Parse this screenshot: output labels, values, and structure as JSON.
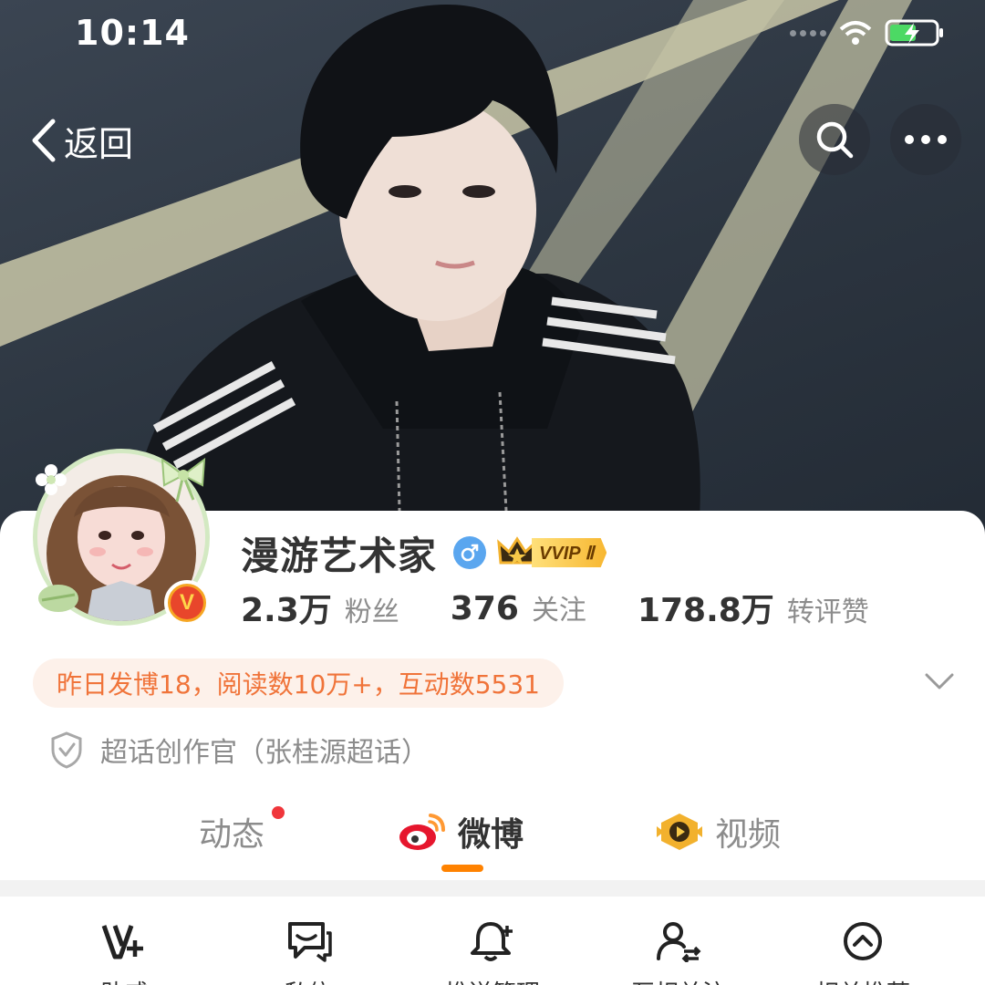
{
  "status_bar": {
    "time": "10:14"
  },
  "nav": {
    "back_label": "返回"
  },
  "profile": {
    "username": "漫游艺术家",
    "vip_level": "VVIP Ⅱ",
    "stats": [
      {
        "value": "2.3万",
        "label": "粉丝"
      },
      {
        "value": "376",
        "label": "关注"
      },
      {
        "value": "178.8万",
        "label": "转评赞"
      }
    ],
    "activity_summary": "昨日发博18，阅读数10万+，互动数5531",
    "super_topic_title": "超话创作官（张桂源超话）"
  },
  "tabs": [
    {
      "label": "动态",
      "has_dot": true
    },
    {
      "label": "微博",
      "active": true
    },
    {
      "label": "视频"
    }
  ],
  "bottom_bar": [
    {
      "label": "助威",
      "icon": "v-plus-icon"
    },
    {
      "label": "私信",
      "icon": "message-icon"
    },
    {
      "label": "推送管理",
      "icon": "bell-plus-icon"
    },
    {
      "label": "互相关注",
      "icon": "user-follow-icon"
    },
    {
      "label": "相关推荐",
      "icon": "chevron-up-circle-icon"
    }
  ],
  "colors": {
    "accent": "#ff8200",
    "activity_text": "#f0743a",
    "activity_bg": "#fdf1ea",
    "gender_blue": "#5aa6ef",
    "notification_red": "#f0363b"
  }
}
